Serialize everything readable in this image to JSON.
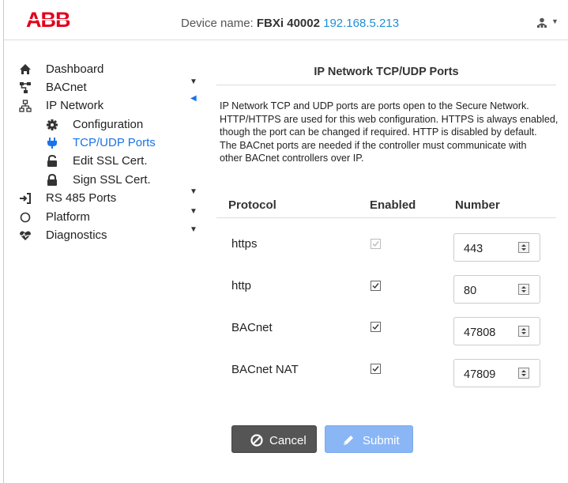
{
  "header": {
    "logo_text": "ABB",
    "device_label": "Device name:",
    "device_name": "FBXi 40002",
    "device_ip": "192.168.5.213",
    "user_icon": "user-network-icon",
    "caret": "▼"
  },
  "sidebar": {
    "items": [
      {
        "label": "Dashboard",
        "icon": "home-icon"
      },
      {
        "label": "BACnet",
        "icon": "hierarchy-icon",
        "arrow": "▼"
      },
      {
        "label": "IP Network",
        "icon": "network-icon",
        "arrow": "◀"
      },
      {
        "label": "Configuration",
        "icon": "gear-icon"
      },
      {
        "label": "TCP/UDP Ports",
        "icon": "plug-icon"
      },
      {
        "label": "Edit SSL Cert.",
        "icon": "unlock-icon"
      },
      {
        "label": "Sign SSL Cert.",
        "icon": "lock-icon"
      },
      {
        "label": "RS 485 Ports",
        "icon": "sign-in-icon",
        "arrow": "▼"
      },
      {
        "label": "Platform",
        "icon": "circle-icon",
        "arrow": "▼"
      },
      {
        "label": "Diagnostics",
        "icon": "heartbeat-icon",
        "arrow": "▼"
      }
    ]
  },
  "main": {
    "title": "IP Network TCP/UDP Ports",
    "description": [
      "IP Network TCP and UDP ports are ports open to the Secure Network.",
      "HTTP/HTTPS are used for this web configuration. HTTPS is always enabled,",
      "though the port can be changed if required. HTTP is disabled by default.",
      "The BACnet ports are needed if the controller must communicate with",
      "other BACnet controllers over IP."
    ],
    "columns": {
      "protocol": "Protocol",
      "enabled": "Enabled",
      "number": "Number"
    },
    "rows": [
      {
        "protocol": "https",
        "enabled": true,
        "disabled": true,
        "number": "443"
      },
      {
        "protocol": "http",
        "enabled": true,
        "disabled": false,
        "number": "80"
      },
      {
        "protocol": "BACnet",
        "enabled": true,
        "disabled": false,
        "number": "47808"
      },
      {
        "protocol": "BACnet NAT",
        "enabled": true,
        "disabled": false,
        "number": "47809"
      }
    ],
    "buttons": {
      "cancel": "Cancel",
      "submit": "Submit"
    }
  },
  "colors": {
    "brand": "#e2001a",
    "link": "#1e90d6",
    "active": "#1a73e8",
    "cancel_bg": "#555555",
    "submit_bg": "#8bb6f5"
  }
}
